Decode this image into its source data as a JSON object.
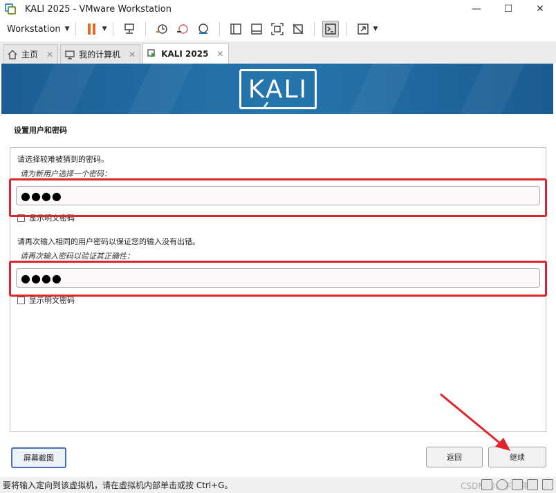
{
  "window": {
    "title": "KALI 2025 - VMware Workstation",
    "minimize": "—",
    "maximize": "☐",
    "close": "✕"
  },
  "toolbar": {
    "workstation_label": "Workstation"
  },
  "tabs": [
    {
      "label": "主页",
      "icon": "home-icon"
    },
    {
      "label": "我的计算机",
      "icon": "computer-icon"
    },
    {
      "label": "KALI 2025",
      "icon": "vm-icon",
      "active": true
    }
  ],
  "installer": {
    "logo_text": "KALI",
    "section_title": "设置用户和密码",
    "hint1": "请选择较难被猜到的密码。",
    "label1": "请为新用户选择一个密码：",
    "password1": "●●●●",
    "show_password1": "显示明文密码",
    "hint2": "请再次输入相同的用户密码以保证您的输入没有出错。",
    "label2": "请再次输入密码以验证其正确性：",
    "password2": "●●●●",
    "show_password2": "显示明文密码",
    "screenshot_button": "屏幕截图",
    "back_button": "返回",
    "continue_button": "继续"
  },
  "colors": {
    "banner": "#2676ad",
    "annotation": "#e0242c"
  },
  "statusbar": {
    "message": "要将输入定向到该虚拟机，请在虚拟机内部单击或按 Ctrl+G。",
    "watermark": "CSDN @创字白泽"
  }
}
